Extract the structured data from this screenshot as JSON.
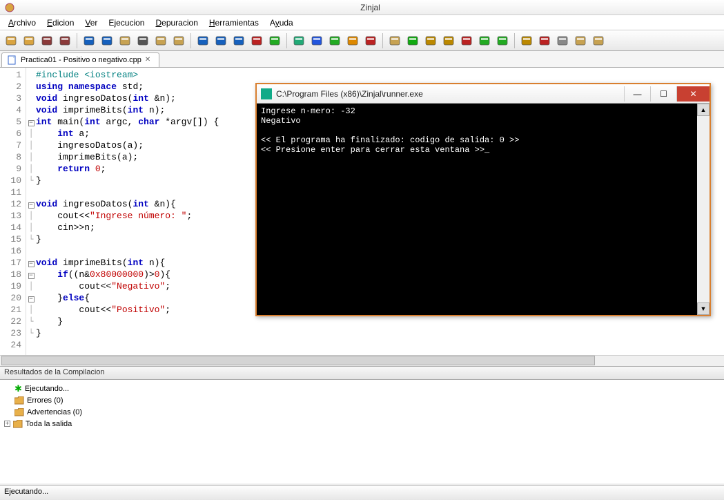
{
  "app": {
    "title": "Zinjal"
  },
  "menu": {
    "items": [
      {
        "label": "Archivo",
        "key": "A"
      },
      {
        "label": "Edicion",
        "key": "E"
      },
      {
        "label": "Ver",
        "key": "V"
      },
      {
        "label": "Ejecucion",
        "key": "j"
      },
      {
        "label": "Depuracion",
        "key": "D"
      },
      {
        "label": "Herramientas",
        "key": "H"
      },
      {
        "label": "Ayuda",
        "key": "y"
      }
    ]
  },
  "toolbar_icons": [
    "new-file",
    "open-file",
    "save-file",
    "save-all",
    "|",
    "undo",
    "redo",
    "copy",
    "cut",
    "paste",
    "find",
    "|",
    "goto-func",
    "find-symbol",
    "bookmark",
    "book-red",
    "book-green",
    "|",
    "hash",
    "books-blue",
    "books-green",
    "books-orange",
    "books-red",
    "|",
    "template",
    "run",
    "debug",
    "step",
    "breakpoint",
    "memory",
    "watch",
    "|",
    "check",
    "tools",
    "settings",
    "mail",
    "help"
  ],
  "tab": {
    "filename": "Practica01 - Positivo o negativo.cpp"
  },
  "code": {
    "lines": [
      {
        "n": 1,
        "fold": "",
        "tokens": [
          [
            "pp",
            "#include <iostream>"
          ]
        ]
      },
      {
        "n": 2,
        "fold": "",
        "tokens": [
          [
            "kw",
            "using"
          ],
          [
            "",
            " "
          ],
          [
            "kw",
            "namespace"
          ],
          [
            "",
            " std;"
          ]
        ]
      },
      {
        "n": 3,
        "fold": "",
        "tokens": [
          [
            "kw",
            "void"
          ],
          [
            "",
            " ingresoDatos("
          ],
          [
            "kw",
            "int"
          ],
          [
            "",
            " &n);"
          ]
        ]
      },
      {
        "n": 4,
        "fold": "",
        "tokens": [
          [
            "kw",
            "void"
          ],
          [
            "",
            " imprimeBits("
          ],
          [
            "kw",
            "int"
          ],
          [
            "",
            " n);"
          ]
        ]
      },
      {
        "n": 5,
        "fold": "-",
        "tokens": [
          [
            "kw",
            "int"
          ],
          [
            "",
            " main("
          ],
          [
            "kw",
            "int"
          ],
          [
            "",
            " argc, "
          ],
          [
            "kw",
            "char"
          ],
          [
            "",
            " *argv[]) {"
          ]
        ]
      },
      {
        "n": 6,
        "fold": "|",
        "tokens": [
          [
            "",
            "    "
          ],
          [
            "kw",
            "int"
          ],
          [
            "",
            " a;"
          ]
        ]
      },
      {
        "n": 7,
        "fold": "|",
        "tokens": [
          [
            "",
            "    ingresoDatos(a);"
          ]
        ]
      },
      {
        "n": 8,
        "fold": "|",
        "tokens": [
          [
            "",
            "    imprimeBits(a);"
          ]
        ]
      },
      {
        "n": 9,
        "fold": "|",
        "tokens": [
          [
            "",
            "    "
          ],
          [
            "kw",
            "return"
          ],
          [
            "",
            " "
          ],
          [
            "num",
            "0"
          ],
          [
            "",
            ";"
          ]
        ]
      },
      {
        "n": 10,
        "fold": "L",
        "tokens": [
          [
            "",
            "}"
          ]
        ]
      },
      {
        "n": 11,
        "fold": "",
        "tokens": [
          [
            "",
            ""
          ]
        ]
      },
      {
        "n": 12,
        "fold": "-",
        "tokens": [
          [
            "kw",
            "void"
          ],
          [
            "",
            " ingresoDatos("
          ],
          [
            "kw",
            "int"
          ],
          [
            "",
            " &n){"
          ]
        ]
      },
      {
        "n": 13,
        "fold": "|",
        "tokens": [
          [
            "",
            "    cout<<"
          ],
          [
            "str",
            "\"Ingrese número: \""
          ],
          [
            "",
            ";"
          ]
        ]
      },
      {
        "n": 14,
        "fold": "|",
        "tokens": [
          [
            "",
            "    cin>>n;"
          ]
        ]
      },
      {
        "n": 15,
        "fold": "L",
        "tokens": [
          [
            "",
            "}"
          ]
        ]
      },
      {
        "n": 16,
        "fold": "",
        "tokens": [
          [
            "",
            ""
          ]
        ]
      },
      {
        "n": 17,
        "fold": "-",
        "tokens": [
          [
            "kw",
            "void"
          ],
          [
            "",
            " imprimeBits("
          ],
          [
            "kw",
            "int"
          ],
          [
            "",
            " n){"
          ]
        ]
      },
      {
        "n": 18,
        "fold": "-",
        "tokens": [
          [
            "",
            "    "
          ],
          [
            "kw",
            "if"
          ],
          [
            "",
            "((n&"
          ],
          [
            "num",
            "0x80000000"
          ],
          [
            "",
            ")>"
          ],
          [
            "num",
            "0"
          ],
          [
            "",
            "){"
          ]
        ]
      },
      {
        "n": 19,
        "fold": "|",
        "tokens": [
          [
            "",
            "        cout<<"
          ],
          [
            "str",
            "\"Negativo\""
          ],
          [
            "",
            ";"
          ]
        ]
      },
      {
        "n": 20,
        "fold": "-",
        "tokens": [
          [
            "",
            "    }"
          ],
          [
            "kw",
            "else"
          ],
          [
            "",
            "{"
          ]
        ]
      },
      {
        "n": 21,
        "fold": "|",
        "tokens": [
          [
            "",
            "        cout<<"
          ],
          [
            "str",
            "\"Positivo\""
          ],
          [
            "",
            ";"
          ]
        ]
      },
      {
        "n": 22,
        "fold": "L",
        "tokens": [
          [
            "",
            "    }"
          ]
        ]
      },
      {
        "n": 23,
        "fold": "L",
        "tokens": [
          [
            "",
            "}"
          ]
        ]
      },
      {
        "n": 24,
        "fold": "",
        "tokens": [
          [
            "",
            ""
          ]
        ]
      }
    ]
  },
  "results": {
    "title": "Resultados de la Compilacion",
    "rows": [
      {
        "icon": "star",
        "label": "Ejecutando..."
      },
      {
        "icon": "folder",
        "label": "Errores (0)"
      },
      {
        "icon": "folder",
        "label": "Advertencias (0)"
      },
      {
        "icon": "folder",
        "label": "Toda la salida",
        "toggle": "+"
      }
    ]
  },
  "status": {
    "text": "Ejecutando..."
  },
  "console": {
    "title": "C:\\Program Files (x86)\\Zinjal\\runner.exe",
    "lines": [
      "Ingrese n·mero: -32",
      "Negativo",
      "",
      "<< El programa ha finalizado: codigo de salida: 0 >>",
      "<< Presione enter para cerrar esta ventana >>_"
    ]
  },
  "icon_colors": {
    "new-file": "#d9a441",
    "open-file": "#d9a441",
    "save-file": "#8b3a3a",
    "save-all": "#8b3a3a",
    "undo": "#1560bd",
    "redo": "#1560bd",
    "copy": "#c7a252",
    "cut": "#555",
    "paste": "#c7a252",
    "find": "#c7a252",
    "goto-func": "#1560bd",
    "find-symbol": "#1560bd",
    "bookmark": "#1560bd",
    "book-red": "#b22",
    "book-green": "#2a2",
    "hash": "#2a7",
    "books-blue": "#25d",
    "books-green": "#2a2",
    "books-orange": "#d80",
    "books-red": "#b22",
    "template": "#c7a252",
    "run": "#1a1",
    "debug": "#b80",
    "step": "#b80",
    "breakpoint": "#b22",
    "memory": "#2a2",
    "watch": "#2a2",
    "check": "#b80",
    "tools": "#b22",
    "settings": "#888",
    "mail": "#c7a252",
    "help": "#c7a252"
  }
}
